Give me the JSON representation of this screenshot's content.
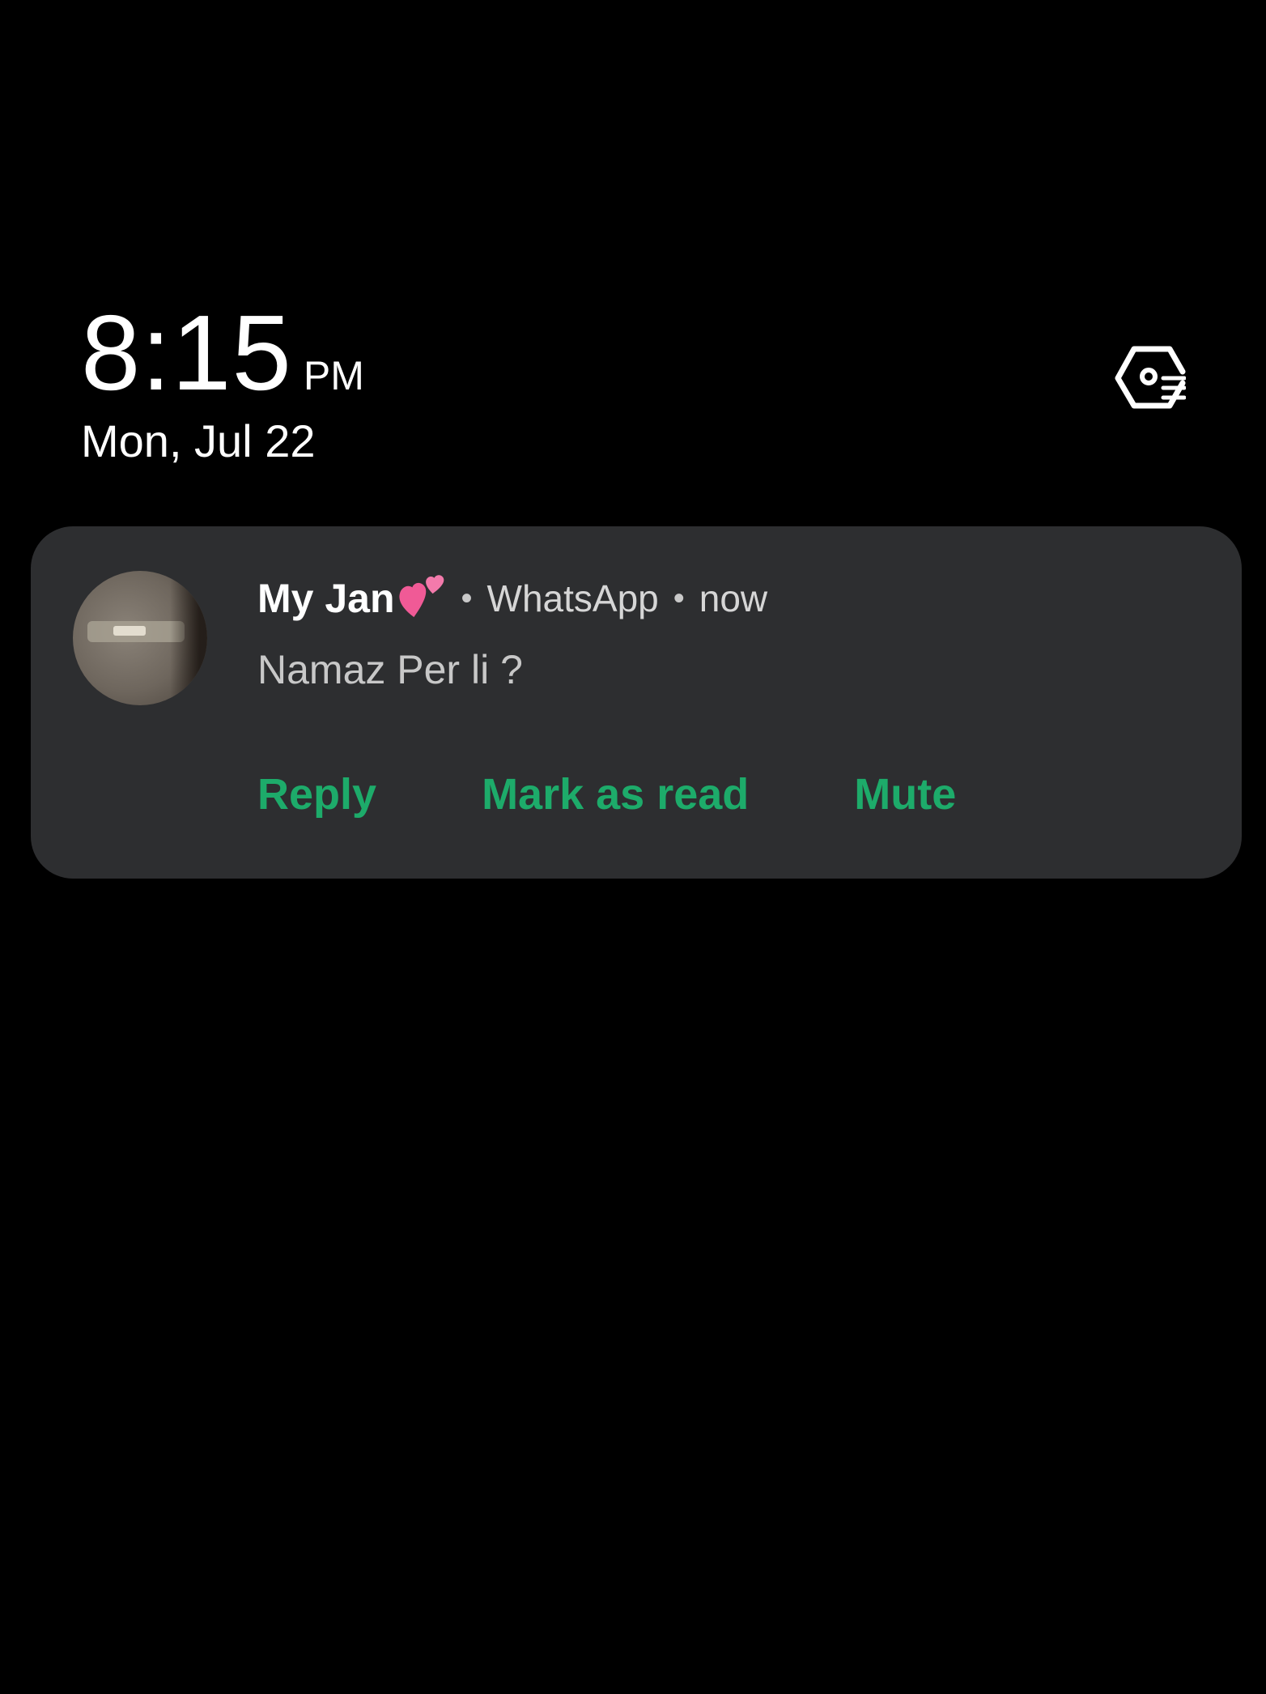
{
  "lockscreen": {
    "time": "8:15",
    "ampm": "PM",
    "date": "Mon, Jul 22",
    "top_icon": "routine-settings-icon"
  },
  "notification": {
    "sender": "My Jan",
    "sender_emoji": "two-hearts-emoji",
    "separator": "•",
    "app": "WhatsApp",
    "time": "now",
    "message": "Namaz Per li ?",
    "avatar_icon": "contact-avatar",
    "actions": [
      {
        "label": "Reply"
      },
      {
        "label": "Mark as read"
      },
      {
        "label": "Mute"
      }
    ],
    "accent_color": "#1dab6a",
    "card_color": "#2d2e30"
  }
}
